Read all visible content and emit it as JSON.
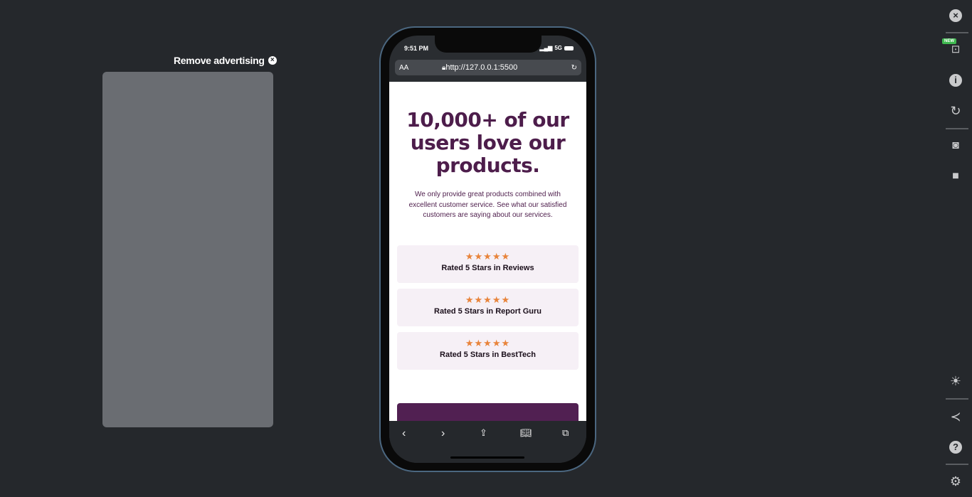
{
  "ad": {
    "remove_label": "Remove advertising"
  },
  "status": {
    "time": "9:51 PM",
    "network": "5G"
  },
  "browser": {
    "aa": "AA",
    "url": "http://127.0.0.1:5500"
  },
  "page": {
    "title": "10,000+ of our users love our products.",
    "description": "We only provide great products combined with excellent customer service. See what our satisfied customers are saying about our services.",
    "ratings": [
      {
        "stars": 5,
        "label": "Rated 5 Stars in Reviews"
      },
      {
        "stars": 5,
        "label": "Rated 5 Stars in Report Guru"
      },
      {
        "stars": 5,
        "label": "Rated 5 Stars in BestTech"
      }
    ],
    "star_color": "#e8843b",
    "accent": "#4d1d4b"
  },
  "rail": {
    "new_badge": "NEW",
    "icons": [
      "close-icon",
      "devices-icon",
      "info-icon",
      "rotate-icon",
      "camera-icon",
      "video-icon",
      "brightness-icon",
      "share-icon",
      "help-icon",
      "settings-icon"
    ]
  }
}
